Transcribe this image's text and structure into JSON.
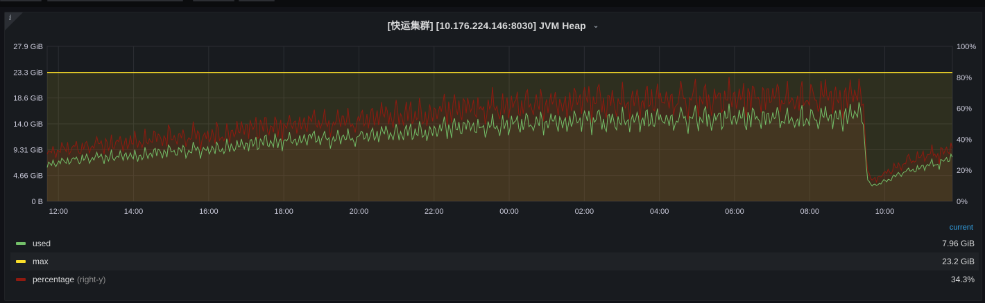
{
  "panel": {
    "title": "[快运集群] [10.176.224.146:8030] JVM Heap",
    "info_glyph": "i",
    "chevron": "⌄"
  },
  "colors": {
    "background": "#111217",
    "panel": "#181b1f",
    "grid": "#2c2e33",
    "used": "#73bf69",
    "max": "#fade2a",
    "percentage": "#8f1a10",
    "legend_header": "#33a2e5"
  },
  "chart_data": {
    "type": "line",
    "x_tick_labels": [
      "12:00",
      "14:00",
      "16:00",
      "18:00",
      "20:00",
      "22:00",
      "00:00",
      "02:00",
      "04:00",
      "06:00",
      "08:00",
      "10:00"
    ],
    "x_range_hours": [
      11.7,
      35.8
    ],
    "y_left": {
      "tick_labels": [
        "0 B",
        "4.66 GiB",
        "9.31 GiB",
        "14.0 GiB",
        "18.6 GiB",
        "23.3 GiB",
        "27.9 GiB"
      ],
      "ylim_gib": [
        0,
        27.9
      ]
    },
    "y_right": {
      "tick_labels": [
        "0%",
        "20%",
        "40%",
        "60%",
        "80%",
        "100%"
      ],
      "ylim_pct": [
        0,
        100
      ]
    },
    "grid": true,
    "series": [
      {
        "name": "used",
        "axis": "left",
        "unit": "GiB",
        "color": "#73bf69",
        "anchors_hours": [
          11.7,
          12.5,
          14,
          16,
          18,
          20,
          22,
          0.0,
          2,
          4,
          6,
          8,
          9.4,
          9.55,
          9.7,
          10.5,
          11.5,
          11.8
        ],
        "anchors_gib": [
          6.5,
          7.5,
          8.3,
          9.4,
          10.8,
          11.6,
          12.8,
          13.8,
          14.6,
          14.8,
          15.0,
          14.9,
          15.5,
          3.5,
          2.8,
          5.2,
          7.0,
          7.96
        ],
        "current": 7.96
      },
      {
        "name": "max",
        "axis": "left",
        "unit": "GiB",
        "color": "#fade2a",
        "value_gib": 23.2,
        "current": 23.2
      },
      {
        "name": "percentage",
        "axis": "right",
        "unit": "%",
        "color": "#8f1a10",
        "anchors_hours": [
          11.7,
          12.5,
          14,
          16,
          18,
          20,
          22,
          0.0,
          2,
          4,
          6,
          8,
          9.4,
          9.55,
          9.7,
          10.5,
          11.5,
          11.8
        ],
        "anchors_pct": [
          30,
          34,
          38,
          42,
          48,
          52,
          57,
          61,
          64,
          65,
          66,
          66,
          67,
          17,
          13,
          24,
          31,
          34.3
        ],
        "current": 34.3
      }
    ]
  },
  "legend": {
    "header": "current",
    "rows": [
      {
        "name": "used",
        "axis_note": "",
        "value": "7.96 GiB",
        "color": "#73bf69"
      },
      {
        "name": "max",
        "axis_note": "",
        "value": "23.2 GiB",
        "color": "#fade2a"
      },
      {
        "name": "percentage",
        "axis_note": "(right-y)",
        "value": "34.3%",
        "color": "#8f1a10"
      }
    ]
  }
}
